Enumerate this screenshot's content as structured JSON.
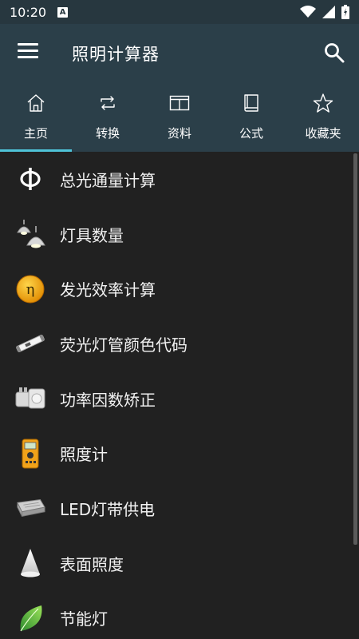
{
  "status": {
    "time": "10:20",
    "badge": "A"
  },
  "app": {
    "title": "照明计算器"
  },
  "tabs": [
    {
      "label": "主页",
      "icon": "home-icon"
    },
    {
      "label": "转换",
      "icon": "swap-icon"
    },
    {
      "label": "资料",
      "icon": "book-open-icon"
    },
    {
      "label": "公式",
      "icon": "book-icon"
    },
    {
      "label": "收藏夹",
      "icon": "star-icon"
    }
  ],
  "list": {
    "items": [
      {
        "label": "总光通量计算",
        "icon": "phi-icon"
      },
      {
        "label": "灯具数量",
        "icon": "lamps-icon"
      },
      {
        "label": "发光效率计算",
        "icon": "eta-icon"
      },
      {
        "label": "荧光灯管颜色代码",
        "icon": "fluorescent-tube-icon"
      },
      {
        "label": "功率因数矫正",
        "icon": "capacitor-icon"
      },
      {
        "label": "照度计",
        "icon": "lux-meter-icon"
      },
      {
        "label": "LED灯带供电",
        "icon": "led-driver-icon"
      },
      {
        "label": "表面照度",
        "icon": "light-cone-icon"
      },
      {
        "label": "节能灯",
        "icon": "leaf-icon"
      }
    ]
  },
  "colors": {
    "appbar": "#2b3f49",
    "statusbar": "#27373f",
    "background": "#212121",
    "accent": "#4fc3d8"
  }
}
